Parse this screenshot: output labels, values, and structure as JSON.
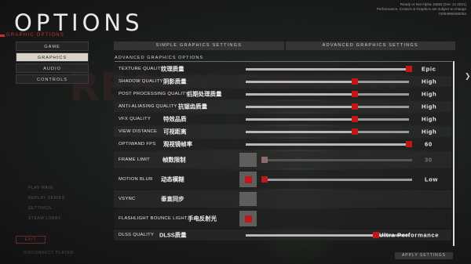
{
  "header": {
    "title": "OPTIONS",
    "subtitle": "GRAPHIC OPTIONS",
    "build_info": [
      "Ready or Not Alpha 16683 (Dec 14 2021)",
      "Performance, Content & Graphics are subject to change",
      "74064998486052"
    ]
  },
  "nav": {
    "items": [
      {
        "label": "GAME",
        "active": false
      },
      {
        "label": "GRAPHICS",
        "active": true
      },
      {
        "label": "AUDIO",
        "active": false
      },
      {
        "label": "CONTROLS",
        "active": false
      }
    ]
  },
  "background_text": "READY OR NOT",
  "faded_menu": [
    "PLAY MAIN",
    "REPLAY SERIES",
    "SETTINGS",
    "STEAM LOBBY"
  ],
  "exit_label": "EXIT",
  "faded_footer": "DISCONNECT PLAYER",
  "tabs": [
    "SIMPLE GRAPHICS SETTINGS",
    "ADVANCED GRAPHICS SETTINGS"
  ],
  "section_label": "ADVANCED GRAPHICS OPTIONS",
  "settings": [
    {
      "label": "TEXTURE QUALITY",
      "zh": "纹理质量",
      "type": "slider",
      "value": "Epic",
      "level": 1.0
    },
    {
      "label": "SHADOW QUALITY",
      "zh": "阴影质量",
      "type": "slider",
      "value": "High",
      "level": 0.667
    },
    {
      "label": "POST PROCESSING QUALITY",
      "zh": "后期处理质量",
      "type": "slider",
      "value": "High",
      "level": 0.667
    },
    {
      "label": "ANTI-ALIASING QUALITY",
      "zh": "抗锯齿质量",
      "type": "slider",
      "value": "High",
      "level": 0.667
    },
    {
      "label": "VFX QUALITY",
      "zh": "特效品质",
      "type": "slider",
      "value": "High",
      "level": 0.667
    },
    {
      "label": "VIEW DISTANCE",
      "zh": "可视距离",
      "type": "slider",
      "value": "High",
      "level": 0.667
    },
    {
      "label": "OPTIWAND FPS",
      "zh": "观视镜帧率",
      "type": "slider",
      "value": "60",
      "level": 1.0
    },
    {
      "label": "FRAME LIMIT",
      "zh": "帧数限制",
      "type": "toggle-slider",
      "enabled": false,
      "value": "30",
      "level": 0.0
    },
    {
      "label": "MOTION BLUR",
      "zh": "动态模糊",
      "type": "toggle-slider",
      "enabled": true,
      "value": "Low",
      "level": 0.0
    },
    {
      "label": "VSYNC",
      "zh": "垂直同步",
      "type": "toggle",
      "enabled": false
    },
    {
      "label": "FLASHLIGHT BOUNCE LIGHT",
      "zh": "手电反射光",
      "type": "toggle",
      "enabled": true
    },
    {
      "label": "DLSS QUALITY",
      "zh": "DLSS质量",
      "type": "slider",
      "value": "Ultra Performance",
      "level": 0.8
    }
  ],
  "apply_label": "APPLY SETTINGS",
  "colors": {
    "accent": "#c01818",
    "subtitle": "#c73030"
  }
}
